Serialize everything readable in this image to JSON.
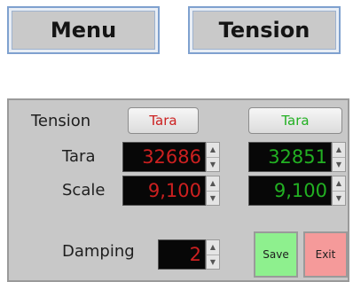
{
  "top_buttons": {
    "menu_label": "Menu",
    "tension_label": "Tension"
  },
  "panel": {
    "tension_label": "Tension",
    "tara_label": "Tara",
    "scale_label": "Scale",
    "damping_label": "Damping",
    "left": {
      "tara_button": "Tara",
      "tara_value": "32686",
      "scale_value": "9,100",
      "color": "#cc2020"
    },
    "right": {
      "tara_button": "Tara",
      "tara_value": "32851",
      "scale_value": "9,100",
      "color": "#22b022"
    },
    "damping_value": "2",
    "save_label": "Save",
    "exit_label": "Exit",
    "save_color": "#8ef08e",
    "exit_color": "#f59a9a"
  }
}
